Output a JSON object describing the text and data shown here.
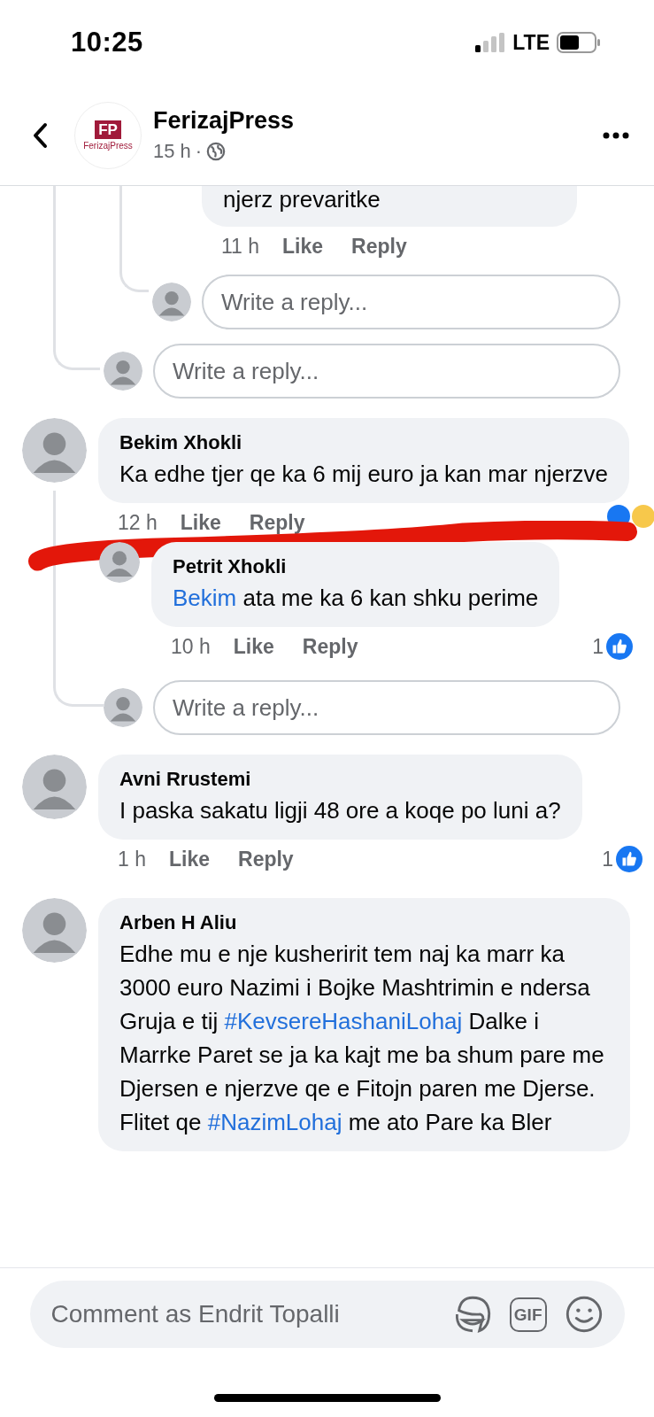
{
  "status_bar": {
    "time": "10:25",
    "network": "LTE"
  },
  "header": {
    "logo": {
      "mark": "FP",
      "wordmark": "FerizajPress"
    },
    "page_name": "FerizajPress",
    "time": "15 h",
    "separator": "·"
  },
  "thread_top": {
    "replies": [
      {
        "text": "njerz prevaritke",
        "time": "11 h",
        "like": "Like",
        "reply": "Reply",
        "reply_field": {
          "placeholder": "Write a reply..."
        }
      }
    ],
    "reply_field": {
      "placeholder": "Write a reply..."
    }
  },
  "comments": [
    {
      "author": "Bekim Xhokli",
      "parts": [
        {
          "kind": "text",
          "text": "Ka edhe tjer qe ka 6 mij euro ja kan mar njerzve"
        }
      ],
      "time": "12 h",
      "like": "Like",
      "reply": "Reply",
      "reactions": true,
      "scribble": true,
      "children": [
        {
          "author": "Petrit Xhokli",
          "parts": [
            {
              "kind": "mention",
              "text": "Bekim"
            },
            {
              "kind": "text",
              "text": " ata me ka 6 kan shku perime"
            }
          ],
          "time": "10 h",
          "like": "Like",
          "reply": "Reply",
          "likes": "1"
        }
      ],
      "reply_field": {
        "placeholder": "Write a reply..."
      }
    },
    {
      "author": "Avni Rrustemi",
      "parts": [
        {
          "kind": "text",
          "text": "I paska sakatu ligji 48 ore a koqe po luni a?"
        }
      ],
      "time": "1 h",
      "like": "Like",
      "reply": "Reply",
      "likes": "1"
    },
    {
      "author": "Arben H Aliu",
      "parts": [
        {
          "kind": "text",
          "text": "Edhe mu e nje kusheririt tem naj ka marr ka 3000 euro Nazimi i Bojke Mashtrimin e ndersa Gruja e tij "
        },
        {
          "kind": "hashtag",
          "text": "#KevsereHashaniLohaj"
        },
        {
          "kind": "text",
          "text": " Dalke i Marrke Paret se ja ka kajt me ba shum pare me Djersen e njerzve qe e Fitojn paren me Djerse.\nFlitet qe "
        },
        {
          "kind": "hashtag",
          "text": "#NazimLohaj"
        },
        {
          "kind": "text",
          "text": " me ato Pare ka Bler"
        }
      ]
    }
  ],
  "composer": {
    "placeholder": "Comment as Endrit Topalli",
    "gif": "GIF"
  }
}
